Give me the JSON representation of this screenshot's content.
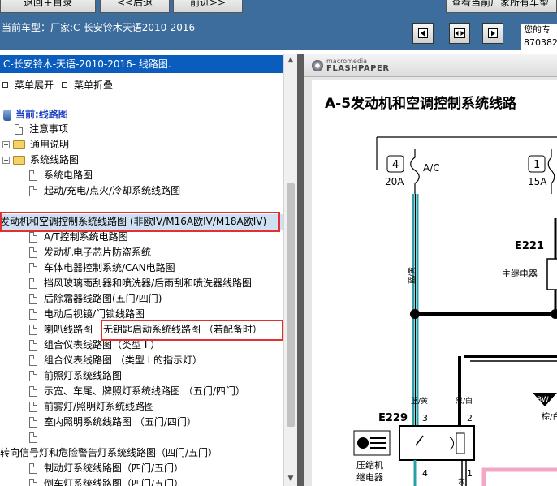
{
  "toolbar": {
    "btn_back_home": "退回主目录",
    "btn_prev": "<<后退",
    "btn_next": "前进>>",
    "btn_view_all": "查看当前厂家所有车型"
  },
  "header": {
    "car_type": "当前车型：厂家:C-长安铃木天语2010-2016",
    "info_line1": "您的专",
    "info_line2": "870382"
  },
  "tree": {
    "title": "C-长安铃木-天语-2010-2016- 线路图.",
    "expand_label": "菜单展开",
    "collapse_label": "菜单折叠",
    "items": [
      {
        "label": "当前:线路图"
      },
      {
        "label": "注意事项"
      },
      {
        "label": "通用说明"
      },
      {
        "label": "系统线路图"
      },
      {
        "label": "系统电路图"
      },
      {
        "label": "起动/充电/点火/冷却系统线路图"
      },
      {
        "label": "发动机和空调控制系统线路图 (非欧IV/M16A欧IV/M18A欧IV)"
      },
      {
        "label": "A/T控制系统电路图"
      },
      {
        "label": "发动机电子芯片防盗系统"
      },
      {
        "label": "车体电器控制系统/CAN电路图"
      },
      {
        "label": "挡风玻璃雨刮器和喷洗器/后雨刮和喷洗器线路图"
      },
      {
        "label": "后除霜器线路图(五门/四门)"
      },
      {
        "label": "电动后视镜/门锁线路图"
      },
      {
        "label": "喇叭线路图"
      },
      {
        "label": "无钥匙启动系统线路图 （若配备时）"
      },
      {
        "label": "组合仪表线路图（类型 I ）"
      },
      {
        "label": "组合仪表线路图 （类型 I 的指示灯）"
      },
      {
        "label": "前照灯系统线路图"
      },
      {
        "label": "示宽、车尾、牌照灯系统线路图 （五门/四门）"
      },
      {
        "label": "前雾灯/照明灯系统线路图"
      },
      {
        "label": "室内照明系统线路图 （五门/四门）"
      },
      {
        "label": "转向信号灯和危险警告灯系统线路图（四门/五门）"
      },
      {
        "label": "制动灯系统线路图（四门/五门）"
      },
      {
        "label": "倒车灯系统线路图（四门/五门）"
      }
    ]
  },
  "viewer": {
    "logo_small": "macromedia",
    "logo_main": "FLASHPAPER",
    "doc_title": "A-5发动机和空调控制系统线路",
    "diagram": {
      "fuse_4_num": "4",
      "fuse_4_amp": "20A",
      "fuse_ac_label": "A/C",
      "fuse_1_num": "1",
      "fuse_1_amp": "15A",
      "wire_color_1": "蓝/黄",
      "wire_color_2": "蓝/黄",
      "wire_color_3": "黑/白",
      "connector_e221": "E221",
      "relay_main_label": "主继电器",
      "connector_e229": "E229",
      "pin_3": "3",
      "pin_2": "2",
      "pin_4": "4",
      "pin_1": "1",
      "compressor_relay_line1": "压缩机",
      "compressor_relay_line2": "继电器",
      "bw_tag": "BW",
      "right_cut_label": "棕/白",
      "bottom_wire_label": "灰"
    }
  },
  "colors": {
    "header_blue": "#3d6d9c",
    "tree_title_blue": "#0a5dbc",
    "highlight_red": "#e23030",
    "wire_teal": "#2a9fa8"
  }
}
